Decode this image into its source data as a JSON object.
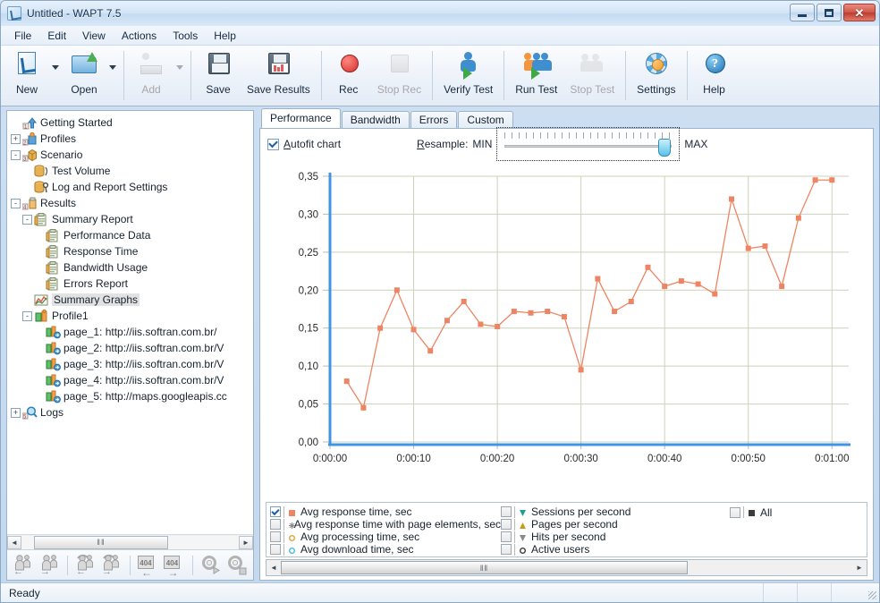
{
  "window": {
    "title": "Untitled - WAPT 7.5",
    "app_icon": "wapt-app-icon",
    "minimize": "minimize-button",
    "maximize": "maximize-button",
    "close": "close-button"
  },
  "menubar": {
    "items": [
      "File",
      "Edit",
      "View",
      "Actions",
      "Tools",
      "Help"
    ]
  },
  "toolbar": {
    "buttons": [
      {
        "label": "New",
        "icon": "new-document-icon",
        "enabled": true,
        "dropdown": true
      },
      {
        "label": "Open",
        "icon": "open-folder-icon",
        "enabled": true,
        "dropdown": true
      },
      {
        "label": "Add",
        "icon": "add-user-icon",
        "enabled": false,
        "dropdown": true
      },
      {
        "label": "Save",
        "icon": "save-disk-icon",
        "enabled": true,
        "dropdown": false
      },
      {
        "label": "Save Results",
        "icon": "save-results-icon",
        "enabled": true,
        "dropdown": false
      },
      {
        "label": "Rec",
        "icon": "record-icon",
        "enabled": true,
        "dropdown": false
      },
      {
        "label": "Stop Rec",
        "icon": "stop-record-icon",
        "enabled": false,
        "dropdown": false
      },
      {
        "label": "Verify Test",
        "icon": "verify-test-icon",
        "enabled": true,
        "dropdown": false
      },
      {
        "label": "Run Test",
        "icon": "run-test-icon",
        "enabled": true,
        "dropdown": false
      },
      {
        "label": "Stop Test",
        "icon": "stop-test-icon",
        "enabled": false,
        "dropdown": false
      },
      {
        "label": "Settings",
        "icon": "settings-gear-icon",
        "enabled": true,
        "dropdown": false
      },
      {
        "label": "Help",
        "icon": "help-question-icon",
        "enabled": true,
        "dropdown": false
      }
    ]
  },
  "tree": {
    "nodes": [
      {
        "label": "Getting Started",
        "depth": 1,
        "expander": "",
        "icon": "getting-started-icon",
        "selected": false
      },
      {
        "label": "Profiles",
        "depth": 1,
        "expander": "+",
        "icon": "profiles-icon",
        "selected": false
      },
      {
        "label": "Scenario",
        "depth": 1,
        "expander": "-",
        "icon": "scenario-icon",
        "selected": false
      },
      {
        "label": "Test Volume",
        "depth": 2,
        "expander": "",
        "icon": "test-volume-icon",
        "selected": false
      },
      {
        "label": "Log and Report Settings",
        "depth": 2,
        "expander": "",
        "icon": "log-settings-icon",
        "selected": false
      },
      {
        "label": "Results",
        "depth": 1,
        "expander": "-",
        "icon": "results-icon",
        "selected": false
      },
      {
        "label": "Summary Report",
        "depth": 2,
        "expander": "-",
        "icon": "report-icon",
        "selected": false
      },
      {
        "label": "Performance Data",
        "depth": 3,
        "expander": "",
        "icon": "report-icon",
        "selected": false
      },
      {
        "label": "Response Time",
        "depth": 3,
        "expander": "",
        "icon": "report-icon",
        "selected": false
      },
      {
        "label": "Bandwidth Usage",
        "depth": 3,
        "expander": "",
        "icon": "report-icon",
        "selected": false
      },
      {
        "label": "Errors Report",
        "depth": 3,
        "expander": "",
        "icon": "report-icon",
        "selected": false
      },
      {
        "label": "Summary Graphs",
        "depth": 2,
        "expander": "",
        "icon": "summary-graphs-icon",
        "selected": true
      },
      {
        "label": "Profile1",
        "depth": 2,
        "expander": "-",
        "icon": "profile-icon",
        "selected": false
      },
      {
        "label": "page_1: http://iis.softran.com.br/",
        "depth": 3,
        "expander": "",
        "icon": "page-icon",
        "selected": false
      },
      {
        "label": "page_2: http://iis.softran.com.br/V",
        "depth": 3,
        "expander": "",
        "icon": "page-icon",
        "selected": false
      },
      {
        "label": "page_3: http://iis.softran.com.br/V",
        "depth": 3,
        "expander": "",
        "icon": "page-icon",
        "selected": false
      },
      {
        "label": "page_4: http://iis.softran.com.br/V",
        "depth": 3,
        "expander": "",
        "icon": "page-icon",
        "selected": false
      },
      {
        "label": "page_5: http://maps.googleapis.cc",
        "depth": 3,
        "expander": "",
        "icon": "page-icon",
        "selected": false
      },
      {
        "label": "Logs",
        "depth": 1,
        "expander": "+",
        "icon": "logs-icon",
        "selected": false
      }
    ],
    "hscroll": {
      "left_arrow": "◄",
      "right_arrow": "►",
      "grip": "‖‖"
    },
    "toolbar_icons": [
      "add-user-left-icon",
      "add-user-right-icon",
      "recycle-user-left-icon",
      "recycle-user-right-icon",
      "error-404-left-icon",
      "error-404-right-icon",
      "gear-run-icon",
      "gear-stop-icon"
    ]
  },
  "tabs": {
    "items": [
      "Performance",
      "Bandwidth",
      "Errors",
      "Custom"
    ],
    "active": "Performance"
  },
  "chart_options": {
    "autofit_label": "Autofit chart",
    "autofit_accel": "A",
    "autofit_checked": true,
    "resample_label": "Resample:",
    "resample_accel": "R",
    "min_label": "MIN",
    "max_label": "MAX",
    "slider_value": 100
  },
  "legend": {
    "left_column": [
      {
        "label": "Avg response time, sec",
        "checked": true,
        "color": "#ed8564",
        "marker": "square"
      },
      {
        "label": "Avg response time with page elements, sec",
        "checked": false,
        "color": "#8a8a8a",
        "marker": "star"
      },
      {
        "label": "Avg processing time, sec",
        "checked": false,
        "color": "#e0a33a",
        "marker": "circle"
      },
      {
        "label": "Avg download time, sec",
        "checked": false,
        "color": "#49b9e8",
        "marker": "circle"
      }
    ],
    "middle_column": [
      {
        "label": "Sessions per second",
        "checked": false,
        "color": "#1f9d8f",
        "marker": "down"
      },
      {
        "label": "Pages per second",
        "checked": false,
        "color": "#c99a20",
        "marker": "up"
      },
      {
        "label": "Hits per second",
        "checked": false,
        "color": "#8a8a8a",
        "marker": "down"
      },
      {
        "label": "Active users",
        "checked": false,
        "color": "#3c3c3c",
        "marker": "circle"
      }
    ],
    "right_column": [
      {
        "label": "All",
        "checked": false,
        "color": "#3c3c3c",
        "marker": "square"
      }
    ]
  },
  "bottom_scroll": {
    "left_arrow": "◄",
    "right_arrow": "►",
    "grip": "‖‖"
  },
  "statusbar": {
    "text": "Ready"
  },
  "chart_data": {
    "type": "line",
    "title": "",
    "xlabel": "",
    "ylabel": "",
    "series_name": "Avg response time, sec",
    "color": "#ed8564",
    "axis_color": "#3f94e8",
    "grid_color": "#ccd2b8",
    "grid": true,
    "legend_position": "bottom",
    "ylim": [
      0.0,
      0.35
    ],
    "yticks": [
      0.0,
      0.05,
      0.1,
      0.15,
      0.2,
      0.25,
      0.3,
      0.35
    ],
    "ytick_labels": [
      "0,00",
      "0,05",
      "0,10",
      "0,15",
      "0,20",
      "0,25",
      "0,30",
      "0,35"
    ],
    "xlim": [
      0,
      62
    ],
    "xticks": [
      0,
      10,
      20,
      30,
      40,
      50,
      60
    ],
    "xtick_labels": [
      "0:00:00",
      "0:00:10",
      "0:00:20",
      "0:00:30",
      "0:00:40",
      "0:00:50",
      "0:01:00"
    ],
    "x": [
      2,
      4,
      6,
      8,
      10,
      12,
      14,
      16,
      18,
      20,
      22,
      24,
      26,
      28,
      30,
      32,
      34,
      36,
      38,
      40,
      42,
      44,
      46,
      48,
      50,
      52,
      54,
      56,
      58,
      60
    ],
    "y": [
      0.08,
      0.045,
      0.15,
      0.2,
      0.148,
      0.12,
      0.16,
      0.185,
      0.155,
      0.152,
      0.172,
      0.17,
      0.172,
      0.165,
      0.095,
      0.215,
      0.172,
      0.185,
      0.23,
      0.205,
      0.212,
      0.208,
      0.195,
      0.32,
      0.255,
      0.258,
      0.205,
      0.295,
      0.345,
      0.345
    ]
  }
}
